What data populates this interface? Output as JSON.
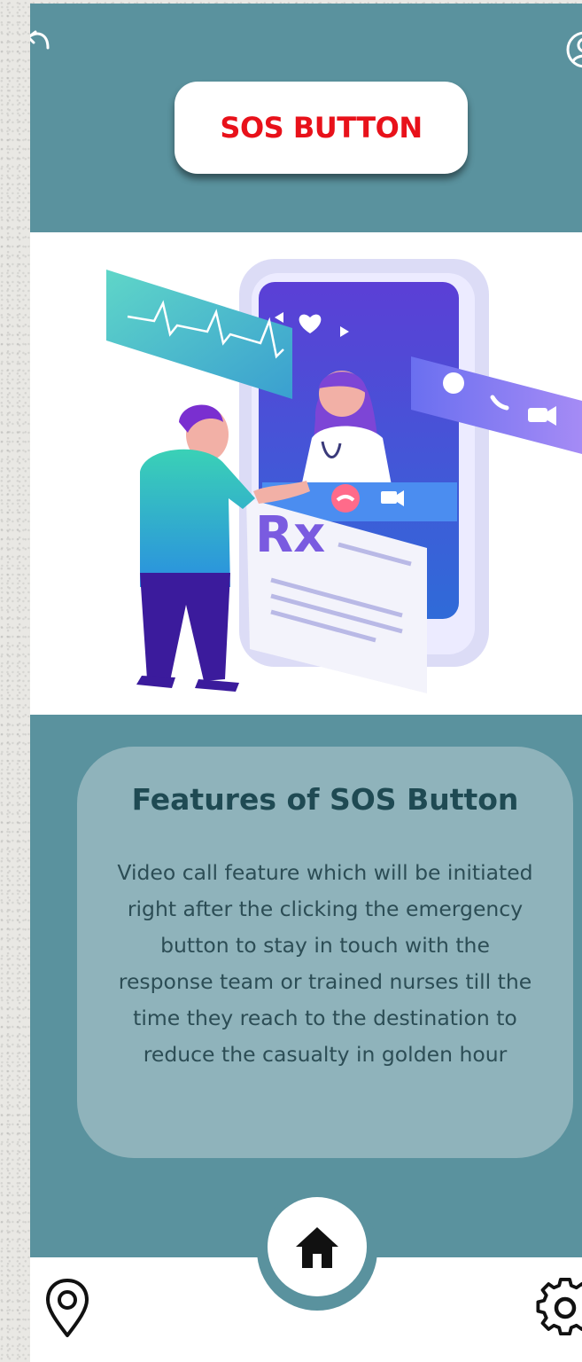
{
  "header": {
    "back_icon": "back-arrow-icon",
    "profile_icon": "user-profile-icon",
    "sos_label": "SOS BUTTON"
  },
  "illustration": {
    "description_icon": "telemedicine-video-call-illustration",
    "prescription_label": "Rx"
  },
  "features": {
    "title": "Features of SOS Button",
    "body": "Video call feature which will be initiated right after the clicking the emergency button to stay in touch with the response team or trained nurses till the time they reach to the destination to reduce the casualty in golden hour"
  },
  "bottom_nav": {
    "left_icon": "location-pin-icon",
    "center_icon": "home-icon",
    "right_icon": "settings-gear-icon"
  },
  "colors": {
    "primary_teal": "#5a929e",
    "card_teal": "#8fb3bb",
    "sos_red": "#e8111a",
    "title_dark": "#1f4a53"
  }
}
